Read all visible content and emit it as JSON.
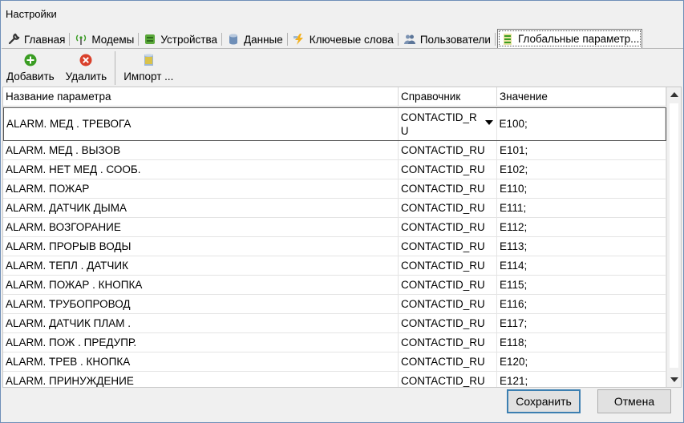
{
  "window": {
    "title": "Настройки"
  },
  "tabs": [
    {
      "label": "Главная",
      "icon": "wrench-icon"
    },
    {
      "label": "Модемы",
      "icon": "antenna-icon"
    },
    {
      "label": "Устройства",
      "icon": "device-icon"
    },
    {
      "label": "Данные",
      "icon": "database-icon"
    },
    {
      "label": "Ключевые слова",
      "icon": "lightning-icon"
    },
    {
      "label": "Пользователи",
      "icon": "users-icon"
    },
    {
      "label": "Глобальные параметр...",
      "icon": "global-params-icon",
      "active": true
    }
  ],
  "toolbar": {
    "add_label": "Добавить",
    "delete_label": "Удалить",
    "import_label": "Импорт ..."
  },
  "grid": {
    "columns": [
      "Название параметра",
      "Справочник",
      "Значение"
    ],
    "rows": [
      {
        "name": "ALARM. МЕД . ТРЕВОГА",
        "ref": "CONTACTID_RU",
        "value": "E100;",
        "selected": true
      },
      {
        "name": "ALARM. МЕД . ВЫЗОВ",
        "ref": "CONTACTID_RU",
        "value": "E101;"
      },
      {
        "name": "ALARM. НЕТ  МЕД . СООБ.",
        "ref": "CONTACTID_RU",
        "value": "E102;"
      },
      {
        "name": "ALARM. ПОЖАР",
        "ref": "CONTACTID_RU",
        "value": "E110;"
      },
      {
        "name": "ALARM. ДАТЧИК ДЫМА",
        "ref": "CONTACTID_RU",
        "value": "E111;"
      },
      {
        "name": "ALARM. ВОЗГОРАНИЕ",
        "ref": "CONTACTID_RU",
        "value": "E112;"
      },
      {
        "name": "ALARM. ПРОРЫВ ВОДЫ",
        "ref": "CONTACTID_RU",
        "value": "E113;"
      },
      {
        "name": "ALARM. ТЕПЛ . ДАТЧИК",
        "ref": "CONTACTID_RU",
        "value": "E114;"
      },
      {
        "name": "ALARM. ПОЖАР . КНОПКА",
        "ref": "CONTACTID_RU",
        "value": "E115;"
      },
      {
        "name": "ALARM. ТРУБОПРОВОД",
        "ref": "CONTACTID_RU",
        "value": "E116;"
      },
      {
        "name": "ALARM.  ДАТЧИК  ПЛАМ .",
        "ref": "CONTACTID_RU",
        "value": "E117;"
      },
      {
        "name": "ALARM. ПОЖ . ПРЕДУПР.",
        "ref": "CONTACTID_RU",
        "value": "E118;"
      },
      {
        "name": "ALARM. ТРЕВ . КНОПКА",
        "ref": "CONTACTID_RU",
        "value": "E120;"
      },
      {
        "name": "ALARM. ПРИНУЖДЕНИЕ",
        "ref": "CONTACTID_RU",
        "value": "E121;"
      }
    ]
  },
  "footer": {
    "save_label": "Сохранить",
    "cancel_label": "Отмена"
  },
  "colors": {
    "window_bg": "#f0f0f0",
    "accent_border": "#3c7fb1",
    "green_icon": "#3a9d23",
    "red_icon": "#d9402b"
  }
}
